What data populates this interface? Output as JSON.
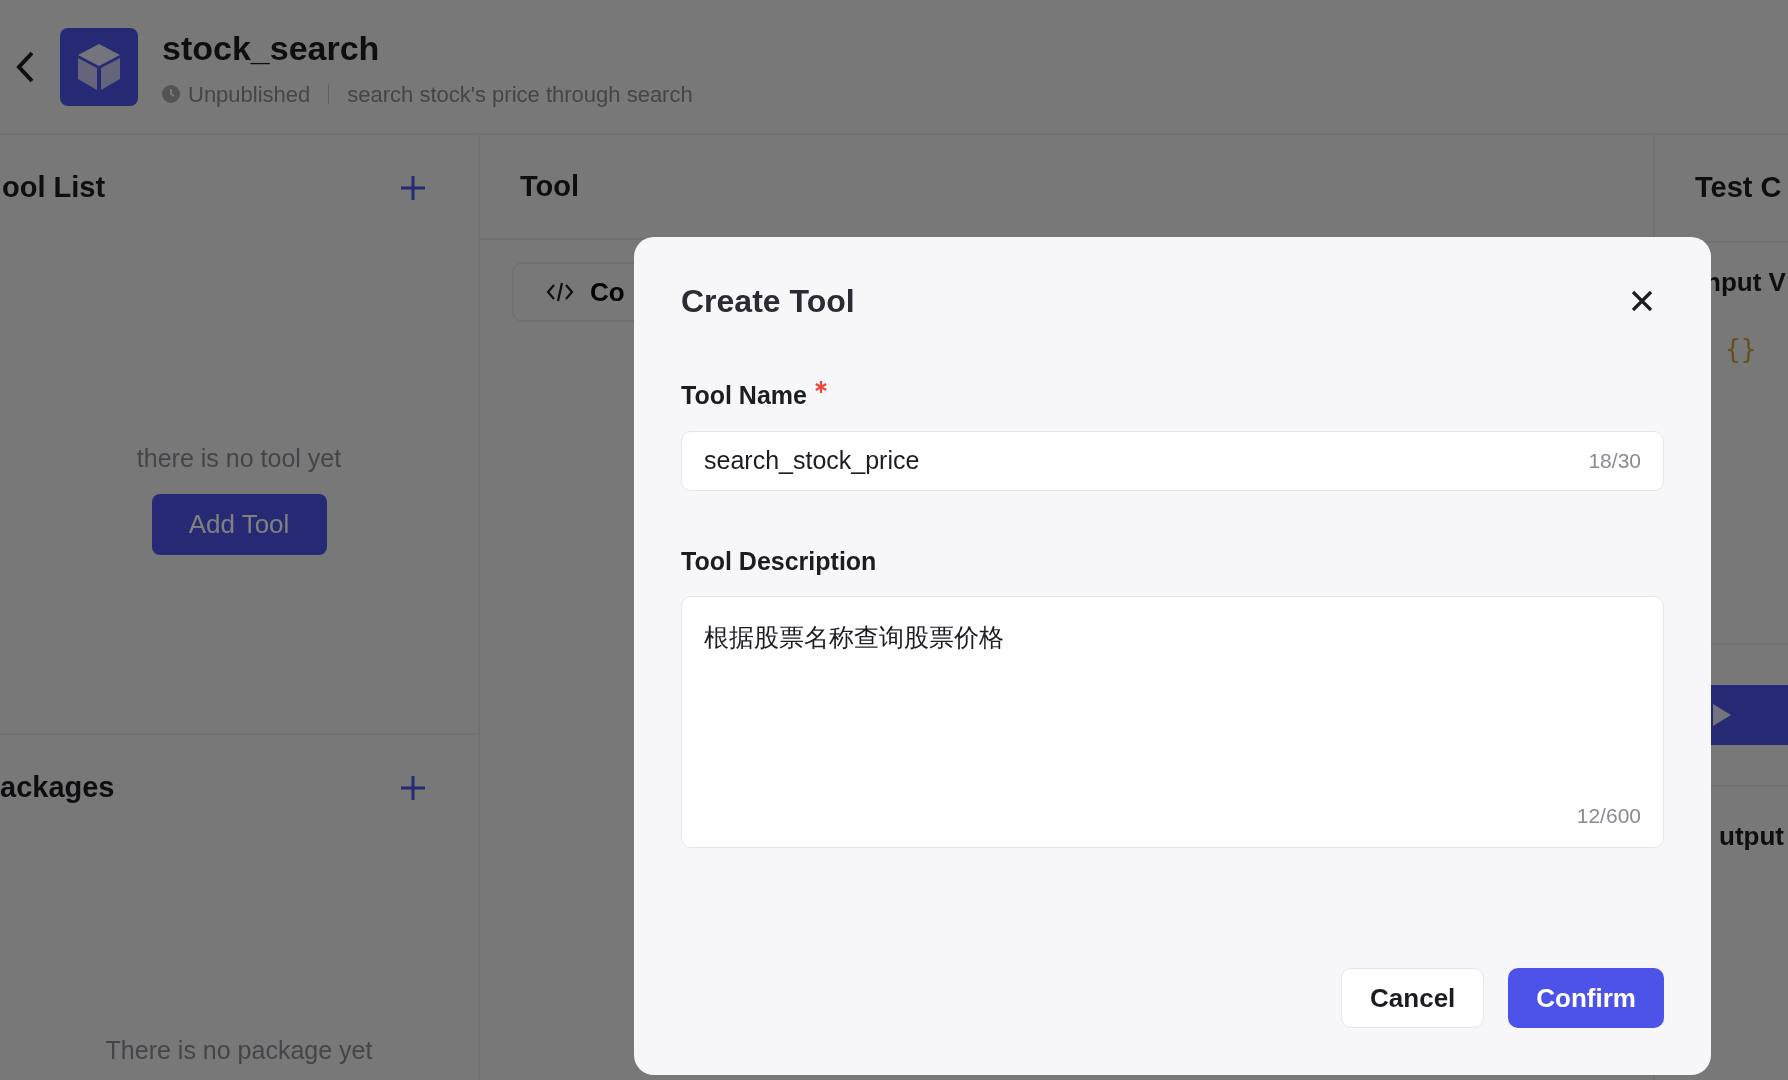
{
  "header": {
    "title": "stock_search",
    "status": "Unpublished",
    "description": "search stock's price through search"
  },
  "left_panel": {
    "tool_list": {
      "title": "ool List",
      "empty_text": "there is no tool yet",
      "add_button": "Add Tool"
    },
    "packages": {
      "title": "ackages",
      "empty_text": "There is no package yet"
    }
  },
  "middle_panel": {
    "title": "Tool",
    "tab": "Co"
  },
  "right_panel": {
    "title": "Test C",
    "input_label": "nput V",
    "input_value": "{}",
    "output_label": "utput"
  },
  "dialog": {
    "title": "Create Tool",
    "fields": [
      {
        "kind": "input",
        "label": "Tool Name",
        "required": true,
        "value": "search_stock_price",
        "counter": "18/30"
      },
      {
        "kind": "textarea",
        "label": "Tool Description",
        "required": false,
        "value": "根据股票名称查询股票价格",
        "counter": "12/600"
      }
    ],
    "buttons": [
      {
        "kind": "secondary",
        "label": "Cancel"
      },
      {
        "kind": "primary",
        "label": "Confirm"
      }
    ]
  }
}
